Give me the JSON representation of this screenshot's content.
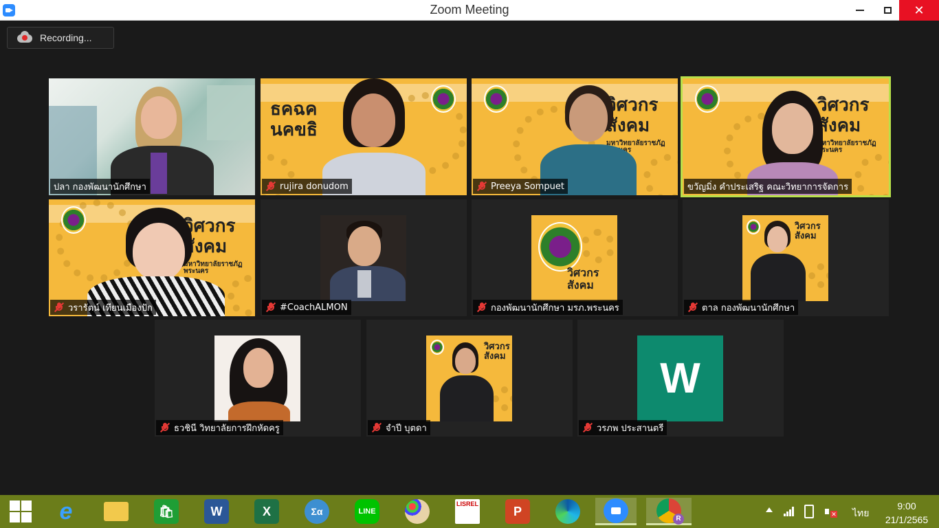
{
  "window": {
    "title": "Zoom Meeting"
  },
  "recording": {
    "label": "Recording..."
  },
  "participants": [
    {
      "name": "ปลา  กองพัฒนานักศึกษา",
      "muted": false,
      "kind": "video-office"
    },
    {
      "name": "rujira donudom",
      "muted": true,
      "kind": "video-banner"
    },
    {
      "name": "Preeya Sompuet",
      "muted": true,
      "kind": "video-banner"
    },
    {
      "name": "ขวัญมิ่ง คำประเสริฐ คณะวิทยาการจัดการ",
      "muted": false,
      "kind": "video-banner",
      "active": true
    },
    {
      "name": "วรารัตน์ เทียนเมืองปัก",
      "muted": true,
      "kind": "video-banner"
    },
    {
      "name": "#CoachALMON",
      "muted": true,
      "kind": "photo"
    },
    {
      "name": "กองพัฒนานักศึกษา มรภ.พระนคร",
      "muted": true,
      "kind": "photo-logo"
    },
    {
      "name": "ตาล กองพัฒนานักศึกษา",
      "muted": true,
      "kind": "photo-banner"
    },
    {
      "name": "ธวชินี  วิทยาลัยการฝึกหัดครู",
      "muted": true,
      "kind": "photo"
    },
    {
      "name": "จำปี บุตดา",
      "muted": true,
      "kind": "photo-banner"
    },
    {
      "name": "วรภพ ประสานตรี",
      "muted": true,
      "kind": "letter",
      "letter": "W"
    }
  ],
  "banner": {
    "line1": "วิศวกร",
    "line2": "สังคม",
    "org": "มหาวิทยาลัยราชภัฏพระนคร",
    "rtext": "ธคฉค",
    "rtext2": "นคขธิ"
  },
  "taskbar": {
    "apps": [
      {
        "name": "start",
        "icon": "windows-icon"
      },
      {
        "name": "internet-explorer",
        "icon": "ie-icon",
        "text": "e"
      },
      {
        "name": "file-explorer",
        "icon": "folder-icon"
      },
      {
        "name": "store",
        "icon": "store-icon"
      },
      {
        "name": "word",
        "icon": "word-icon",
        "text": "W"
      },
      {
        "name": "excel",
        "icon": "excel-icon",
        "text": "X"
      },
      {
        "name": "math",
        "icon": "math-icon",
        "text": "Σα"
      },
      {
        "name": "line",
        "icon": "line-icon",
        "text": "LINE"
      },
      {
        "name": "paint",
        "icon": "paint-icon"
      },
      {
        "name": "lisrel",
        "icon": "lisrel-icon",
        "text": "LISREL"
      },
      {
        "name": "powerpoint",
        "icon": "powerpoint-icon",
        "text": "P"
      },
      {
        "name": "edge",
        "icon": "edge-icon"
      },
      {
        "name": "zoom",
        "icon": "zoom-icon"
      },
      {
        "name": "chrome",
        "icon": "chrome-icon",
        "badge": "R"
      }
    ],
    "language": "ไทย",
    "time": "9:00",
    "date": "21/1/2565"
  },
  "colors": {
    "accent": "#b8e04a",
    "taskbar": "#6b7d1a",
    "banner": "#f5b93c",
    "closeRed": "#e81123"
  }
}
